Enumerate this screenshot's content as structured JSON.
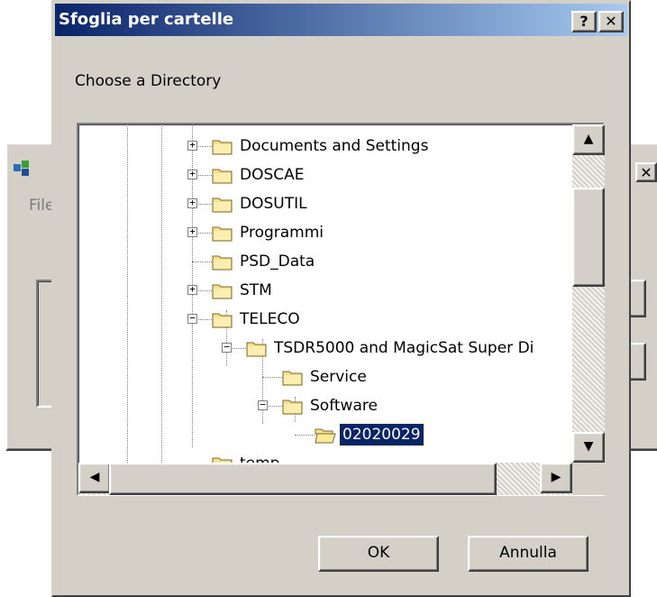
{
  "background_window": {
    "file_label": "File"
  },
  "dialog": {
    "title": "Sfoglia per cartelle",
    "help_label": "?",
    "close_label": "✕",
    "prompt": "Choose a Directory",
    "tree": [
      {
        "label": "Documents and Settings",
        "level": 0,
        "expander": "+"
      },
      {
        "label": "DOSCAE",
        "level": 0,
        "expander": "+"
      },
      {
        "label": "DOSUTIL",
        "level": 0,
        "expander": "+"
      },
      {
        "label": "Programmi",
        "level": 0,
        "expander": "+"
      },
      {
        "label": "PSD_Data",
        "level": 0,
        "expander": ""
      },
      {
        "label": "STM",
        "level": 0,
        "expander": "+"
      },
      {
        "label": "TELECO",
        "level": 0,
        "expander": "−"
      },
      {
        "label": "TSDR5000 and MagicSat Super Di",
        "level": 1,
        "expander": "−"
      },
      {
        "label": "Service",
        "level": 2,
        "expander": ""
      },
      {
        "label": "Software",
        "level": 2,
        "expander": "−"
      },
      {
        "label": "02020029",
        "level": 3,
        "expander": "",
        "selected": true,
        "open": true
      },
      {
        "label": "temp",
        "level": 0,
        "expander": ""
      }
    ],
    "ok_label": "OK",
    "cancel_label": "Annulla"
  },
  "colors": {
    "face": "#d4d0c8",
    "title_start": "#0a246a",
    "title_end": "#a6caf0",
    "folder": "#f5df8d"
  }
}
